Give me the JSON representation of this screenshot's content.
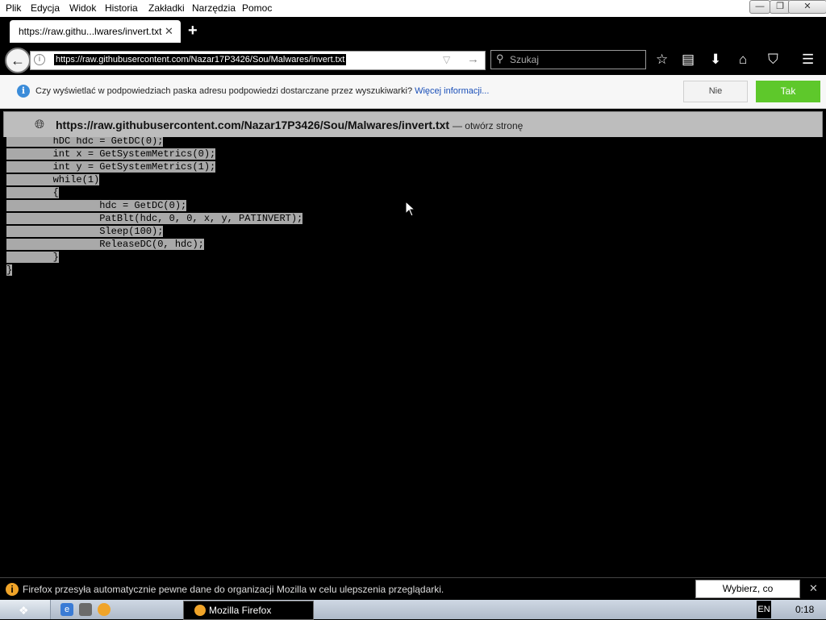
{
  "menubar": {
    "items": [
      "Plik",
      "Edycja",
      "Widok",
      "Historia",
      "Zakładki",
      "Narzędzia",
      "Pomoc"
    ],
    "window_controls": {
      "minimize": "—",
      "restore": "❐",
      "close": "✕"
    }
  },
  "tabs": [
    {
      "title": "https://raw.githu...lwares/invert.txt",
      "close": "✕"
    }
  ],
  "new_tab_label": "+",
  "navbar": {
    "back_glyph": "←",
    "url": "https://raw.githubusercontent.com/Nazar17P3426/Sou/Malwares/invert.txt",
    "search_placeholder": "Szukaj",
    "icons": [
      "star-icon",
      "reader-icon",
      "download-icon",
      "home-icon",
      "pocket-icon",
      "menu-icon"
    ]
  },
  "notification": {
    "text": "Czy wyświetlać w podpowiedziach paska adresu podpowiedzi dostarczane przez wyszukiwarki?",
    "link": "Więcej informacji...",
    "no_label": "Nie",
    "yes_label": "Tak",
    "yes_color": "#5ec82b"
  },
  "suggestion": {
    "url": "https://raw.githubusercontent.com/Nazar17P3426/Sou/Malwares/invert.txt",
    "action": "— otwórz stronę"
  },
  "code_lines": [
    "        hDC hdc = GetDC(0);",
    "        int x = GetSystemMetrics(0);",
    "        int y = GetSystemMetrics(1);",
    "        while(1)",
    "        {",
    "                hdc = GetDC(0);",
    "                PatBlt(hdc, 0, 0, x, y, PATINVERT);",
    "                Sleep(100);",
    "                ReleaseDC(0, hdc);",
    "        }",
    "}"
  ],
  "firefox_bar": {
    "text": "Firefox przesyła automatycznie pewne dane do organizacji Mozilla w celu ulepszenia przeglądarki.",
    "button": "Wybierz, co udostępniać",
    "close": "✕"
  },
  "taskbar": {
    "task_label": "Mozilla Firefox",
    "lang": "EN",
    "clock": "0:18"
  }
}
